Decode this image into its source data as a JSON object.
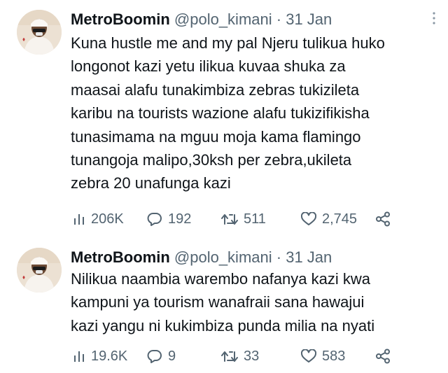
{
  "tweets": [
    {
      "display_name": "MetroBoomin",
      "handle": "@polo_kimani",
      "separator": "·",
      "date": "31 Jan",
      "body_lines": [
        "Kuna hustle me and my pal Njeru tulikua huko",
        "longonot kazi  yetu ilikua kuvaa shuka za",
        "maasai alafu tunakimbiza zebras tukizileta",
        "karibu na tourists wazione alafu tukizifikisha",
        "tunasimama na mguu moja kama flamingo",
        "tunangoja malipo,30ksh per zebra,ukileta",
        "zebra 20 unafunga kazi"
      ],
      "views": "206K",
      "replies": "192",
      "retweets": "511",
      "likes": "2,745"
    },
    {
      "display_name": "MetroBoomin",
      "handle": "@polo_kimani",
      "separator": "·",
      "date": "31 Jan",
      "body_lines": [
        "Nilikua naambia warembo nafanya kazi kwa",
        "kampuni ya tourism wanafraii sana hawajui",
        "kazi yangu ni kukimbiza punda milia na nyati"
      ],
      "views": "19.6K",
      "replies": "9",
      "retweets": "33",
      "likes": "583"
    }
  ],
  "icons": {
    "views": "views-icon",
    "reply": "reply-icon",
    "retweet": "retweet-icon",
    "like": "like-icon",
    "share": "share-icon",
    "more": "more-icon"
  },
  "colors": {
    "text": "#0f1419",
    "secondary": "#536471",
    "background": "#ffffff"
  }
}
